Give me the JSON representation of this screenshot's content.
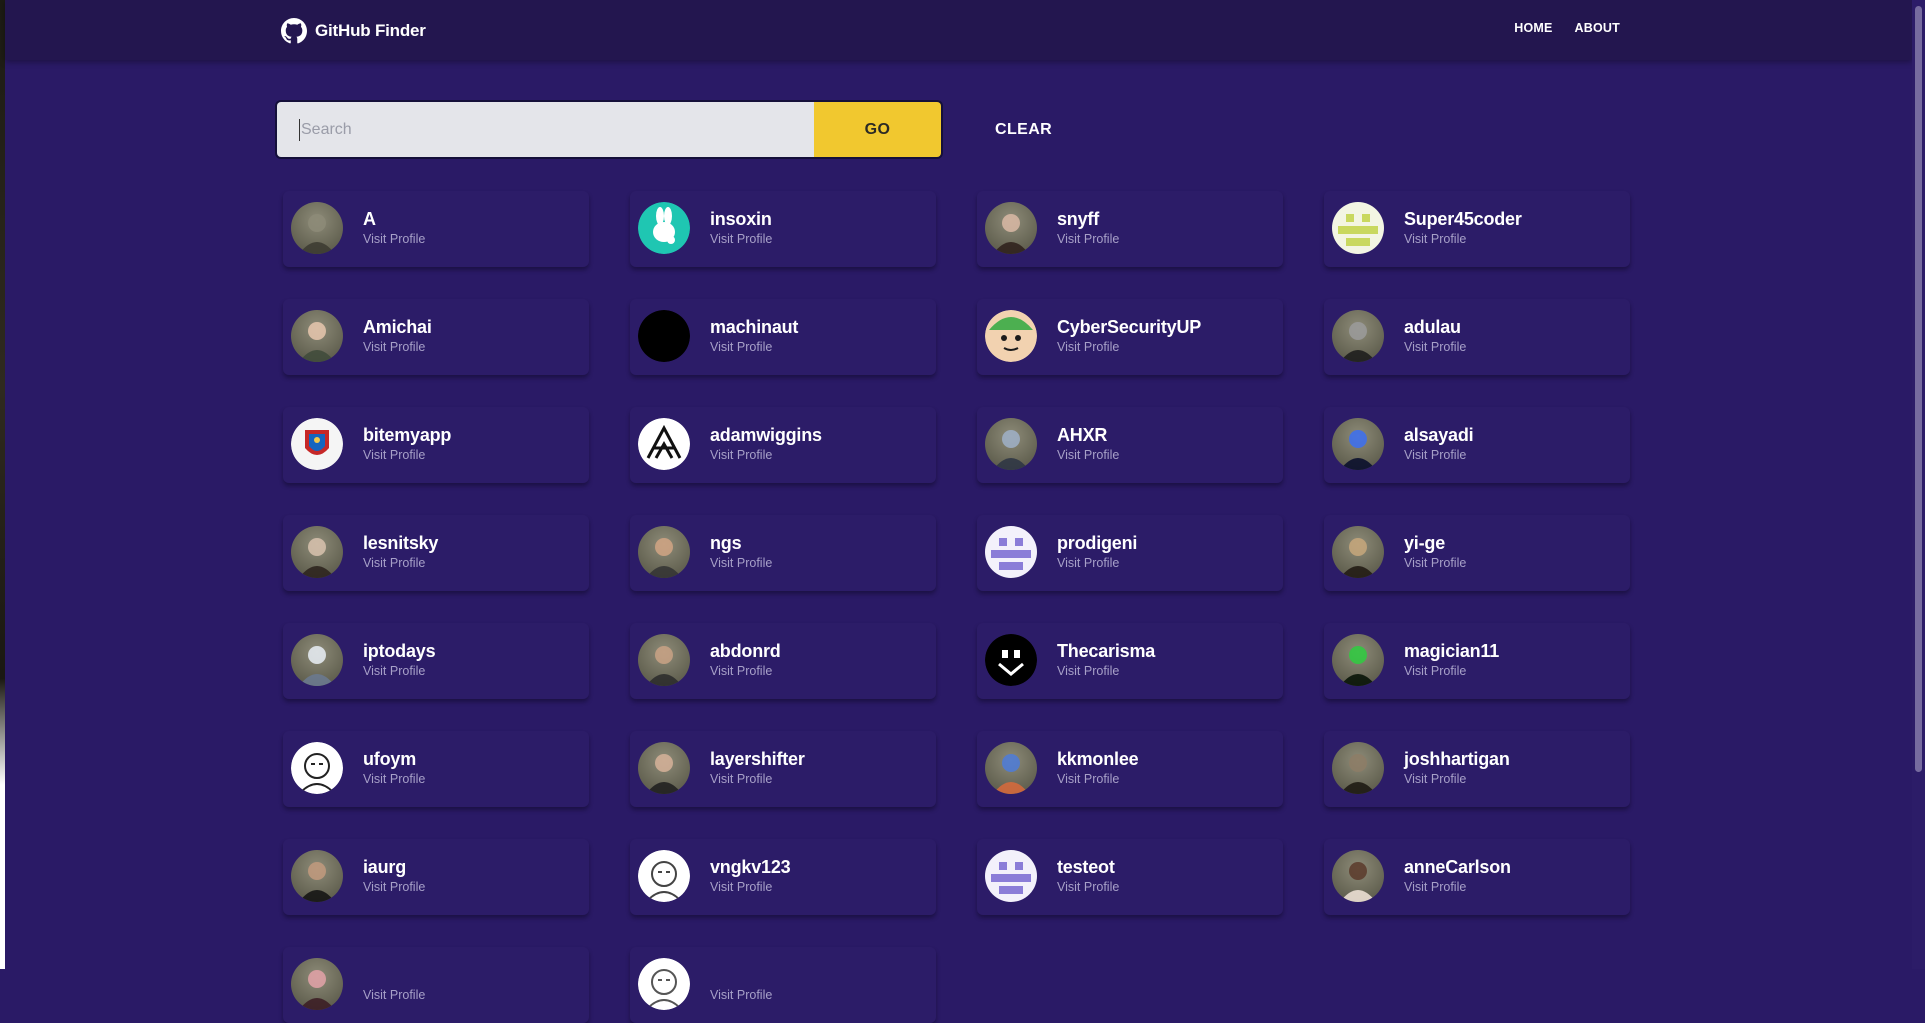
{
  "app": {
    "title": "GitHub Finder"
  },
  "nav": {
    "items": [
      {
        "label": "HOME"
      },
      {
        "label": "ABOUT"
      }
    ]
  },
  "search": {
    "placeholder": "Search",
    "value": "",
    "go_label": "GO",
    "clear_label": "CLEAR"
  },
  "users": {
    "visit_label": "Visit Profile",
    "list": [
      {
        "login": "A",
        "avatar": "photo",
        "colors": [
          "#5b5a4a",
          "#8d8b78",
          "#3b3a30"
        ]
      },
      {
        "login": "insoxin",
        "avatar": "rabbit-icon",
        "colors": [
          "#1fc6b2",
          "#ffffff"
        ]
      },
      {
        "login": "snyff",
        "avatar": "photo",
        "colors": [
          "#6b4a3e",
          "#d9b8a4",
          "#2d1e1a"
        ]
      },
      {
        "login": "Super45coder",
        "avatar": "identicon",
        "colors": [
          "#c9d85f",
          "#f3f5e3"
        ]
      },
      {
        "login": "Amichai",
        "avatar": "photo",
        "colors": [
          "#8bb07a",
          "#e7c7ae",
          "#3e4a3a"
        ]
      },
      {
        "login": "machinaut",
        "avatar": "solid",
        "colors": [
          "#000000",
          "#000000"
        ]
      },
      {
        "login": "CyberSecurityUP",
        "avatar": "cartoon",
        "colors": [
          "#4caf50",
          "#f2d2b0",
          "#1b1b1b"
        ]
      },
      {
        "login": "adulau",
        "avatar": "photo",
        "colors": [
          "#3a3a3a",
          "#9b9b9b",
          "#1a1a1a"
        ]
      },
      {
        "login": "bitemyapp",
        "avatar": "crest",
        "colors": [
          "#f5f5f5",
          "#c62828",
          "#1565c0"
        ]
      },
      {
        "login": "adamwiggins",
        "avatar": "emblem",
        "colors": [
          "#ffffff",
          "#111111"
        ]
      },
      {
        "login": "AHXR",
        "avatar": "photo",
        "colors": [
          "#5a6c86",
          "#9fb0c8",
          "#2b3443"
        ]
      },
      {
        "login": "alsayadi",
        "avatar": "photo",
        "colors": [
          "#0b1a5a",
          "#3b6ff2",
          "#050b2a"
        ]
      },
      {
        "login": "lesnitsky",
        "avatar": "photo",
        "colors": [
          "#6d5c4e",
          "#d8c2ae",
          "#2a211b"
        ]
      },
      {
        "login": "ngs",
        "avatar": "photo",
        "colors": [
          "#f2f2f2",
          "#d1a584",
          "#333333"
        ]
      },
      {
        "login": "prodigeni",
        "avatar": "identicon",
        "colors": [
          "#8b7dd8",
          "#f3f1fb"
        ]
      },
      {
        "login": "yi-ge",
        "avatar": "photo",
        "colors": [
          "#4a3a2a",
          "#c7a77b",
          "#1f1710"
        ]
      },
      {
        "login": "iptodays",
        "avatar": "photo",
        "colors": [
          "#9fb0c9",
          "#e9eef6",
          "#6b7a92"
        ]
      },
      {
        "login": "abdonrd",
        "avatar": "photo",
        "colors": [
          "#f2f2f2",
          "#c9a285",
          "#2a2a2a"
        ]
      },
      {
        "login": "Thecarisma",
        "avatar": "face-icon",
        "colors": [
          "#000000",
          "#ffffff"
        ]
      },
      {
        "login": "magician11",
        "avatar": "photo",
        "colors": [
          "#0b1f0b",
          "#2ecc40",
          "#041004"
        ]
      },
      {
        "login": "ufoym",
        "avatar": "sketch",
        "colors": [
          "#ffffff",
          "#222222"
        ]
      },
      {
        "login": "layershifter",
        "avatar": "photo",
        "colors": [
          "#f5f5f5",
          "#d6b199",
          "#1d1d1d"
        ]
      },
      {
        "login": "kkmonlee",
        "avatar": "photo",
        "colors": [
          "#101432",
          "#4c7bd9",
          "#d96a3b"
        ]
      },
      {
        "login": "joshhartigan",
        "avatar": "photo",
        "colors": [
          "#3a3327",
          "#8d7d66",
          "#1a160f"
        ]
      },
      {
        "login": "iaurg",
        "avatar": "photo",
        "colors": [
          "#2b2220",
          "#c29a7e",
          "#101010"
        ]
      },
      {
        "login": "vngkv123",
        "avatar": "sketch",
        "colors": [
          "#ffffff",
          "#444444"
        ]
      },
      {
        "login": "testeot",
        "avatar": "identicon",
        "colors": [
          "#8b7dd8",
          "#f3f1fb"
        ]
      },
      {
        "login": "anneCarlson",
        "avatar": "photo",
        "colors": [
          "#d9c6b3",
          "#5a3a2a",
          "#f3e6da"
        ]
      },
      {
        "login": "",
        "avatar": "photo",
        "colors": [
          "#7a3a4a",
          "#e3a2a8",
          "#3a1a22"
        ]
      },
      {
        "login": "",
        "avatar": "sketch",
        "colors": [
          "#ffffff",
          "#555555"
        ]
      }
    ]
  }
}
